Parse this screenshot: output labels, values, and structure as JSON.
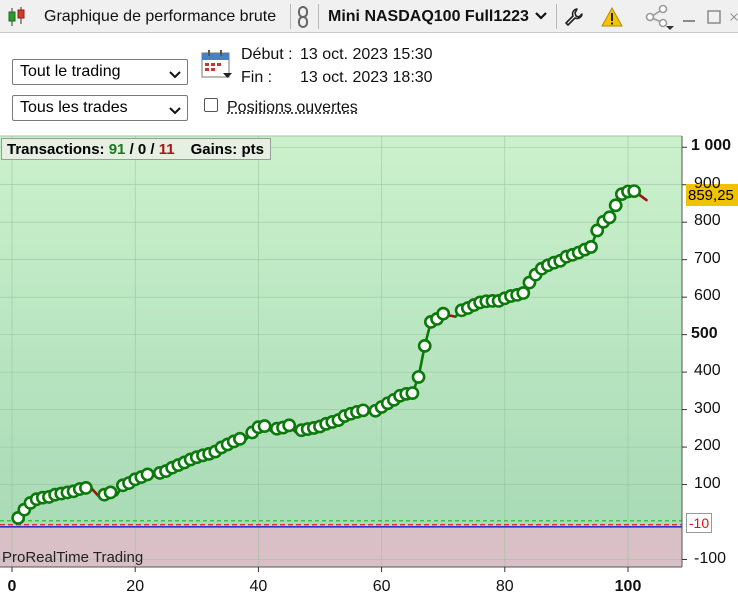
{
  "toolbar": {
    "window_title": "Graphique de performance brute",
    "instrument": "Mini NASDAQ100 Full1223"
  },
  "controls": {
    "period_select": "Tout le trading",
    "trades_select": "Tous les trades",
    "start_label": "Début :",
    "start_value": "13 oct. 2023 15:30",
    "end_label": "Fin :",
    "end_value": "13 oct. 2023 18:30",
    "open_positions_label": "Positions ouvertes",
    "open_positions_checked": false
  },
  "stats": {
    "transactions_label": "Transactions:",
    "winning": "91",
    "separator": "/",
    "neutral": "0",
    "losing": "11",
    "gains_label": "Gains: pts"
  },
  "brand": "ProRealTime Trading",
  "last_value_label": "859,25",
  "zero_line_label": "-10",
  "colors": {
    "gain_zone": "#c8efce",
    "loss_zone": "#d9c0c6",
    "curve": "#0a7a0a",
    "down_segment": "#a50f0f",
    "price_tag": "#f2c200"
  },
  "chart_data": {
    "type": "line",
    "title": "",
    "xlabel": "",
    "ylabel": "Gains: pts",
    "xlim": [
      0,
      107
    ],
    "ylim": [
      -120,
      1030
    ],
    "x_ticks": [
      {
        "value": 0,
        "label": "0",
        "major": true
      },
      {
        "value": 20,
        "label": "20",
        "major": false
      },
      {
        "value": 40,
        "label": "40",
        "major": false
      },
      {
        "value": 60,
        "label": "60",
        "major": false
      },
      {
        "value": 80,
        "label": "80",
        "major": false
      },
      {
        "value": 100,
        "label": "100",
        "major": true
      }
    ],
    "y_ticks": [
      {
        "value": 1000,
        "label": "1 000",
        "major": true
      },
      {
        "value": 900,
        "label": "900",
        "major": false
      },
      {
        "value": 800,
        "label": "800",
        "major": false
      },
      {
        "value": 700,
        "label": "700",
        "major": false
      },
      {
        "value": 600,
        "label": "600",
        "major": false
      },
      {
        "value": 500,
        "label": "500",
        "major": true
      },
      {
        "value": 400,
        "label": "400",
        "major": false
      },
      {
        "value": 300,
        "label": "300",
        "major": false
      },
      {
        "value": 200,
        "label": "200",
        "major": false
      },
      {
        "value": 100,
        "label": "100",
        "major": false
      },
      {
        "value": -100,
        "label": "-100",
        "major": false
      }
    ],
    "grid": true,
    "baseline": -10,
    "series": [
      {
        "name": "",
        "x": [
          1,
          2,
          3,
          4,
          5,
          6,
          7,
          8,
          9,
          10,
          11,
          12,
          13,
          14,
          15,
          16,
          17,
          18,
          19,
          20,
          21,
          22,
          23,
          24,
          25,
          26,
          27,
          28,
          29,
          30,
          31,
          32,
          33,
          34,
          35,
          36,
          37,
          38,
          39,
          40,
          41,
          42,
          43,
          44,
          45,
          46,
          47,
          48,
          49,
          50,
          51,
          52,
          53,
          54,
          55,
          56,
          57,
          58,
          59,
          60,
          61,
          62,
          63,
          64,
          65,
          66,
          67,
          68,
          69,
          70,
          71,
          72,
          73,
          74,
          75,
          76,
          77,
          78,
          79,
          80,
          81,
          82,
          83,
          84,
          85,
          86,
          87,
          88,
          89,
          90,
          91,
          92,
          93,
          94,
          95,
          96,
          97,
          98,
          99,
          100,
          101,
          102,
          103
        ],
        "y": [
          11,
          33,
          51,
          61,
          65,
          67,
          73,
          76,
          79,
          82,
          88,
          91,
          88,
          70,
          73,
          79,
          72,
          98,
          104,
          114,
          120,
          127,
          126,
          131,
          136,
          145,
          152,
          159,
          167,
          173,
          178,
          182,
          188,
          199,
          207,
          215,
          222,
          221,
          239,
          253,
          256,
          244,
          249,
          252,
          258,
          241,
          245,
          248,
          251,
          255,
          262,
          267,
          272,
          283,
          289,
          294,
          298,
          296,
          297,
          307,
          317,
          326,
          337,
          342,
          344,
          387,
          470,
          534,
          542,
          556,
          551,
          548,
          565,
          571,
          579,
          586,
          589,
          590,
          590,
          597,
          603,
          606,
          611,
          639,
          660,
          676,
          685,
          692,
          697,
          708,
          713,
          719,
          727,
          734,
          778,
          801,
          813,
          845,
          875,
          882,
          883,
          871,
          859
        ]
      }
    ]
  }
}
